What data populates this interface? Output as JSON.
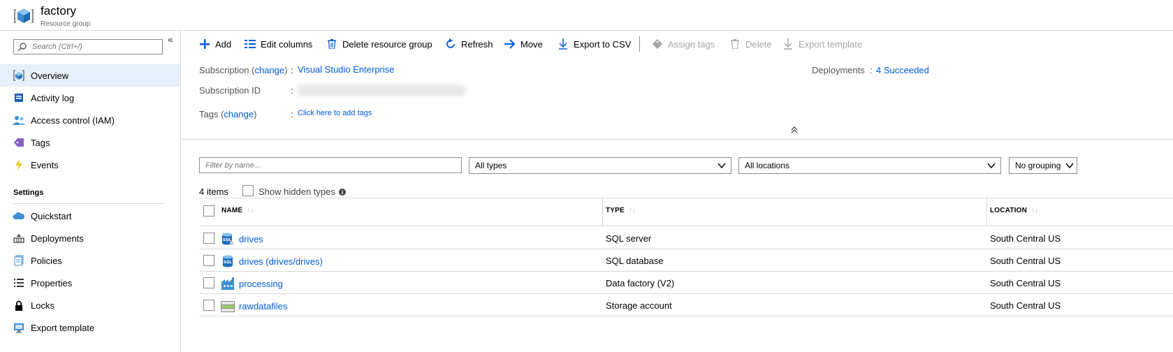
{
  "header": {
    "title": "factory",
    "subtitle": "Resource group",
    "icon": "resource-group-cube-icon"
  },
  "sidebar": {
    "search_placeholder": "Search (Ctrl+/)",
    "collapse_glyph": "«",
    "items": [
      {
        "label": "Overview",
        "icon": "overview-icon"
      },
      {
        "label": "Activity log",
        "icon": "activity-log-icon"
      },
      {
        "label": "Access control (IAM)",
        "icon": "people-icon"
      },
      {
        "label": "Tags",
        "icon": "tag-icon"
      },
      {
        "label": "Events",
        "icon": "lightning-icon"
      }
    ],
    "section": "Settings",
    "settings_items": [
      {
        "label": "Quickstart",
        "icon": "cloud-icon"
      },
      {
        "label": "Deployments",
        "icon": "deployments-icon"
      },
      {
        "label": "Policies",
        "icon": "policies-icon"
      },
      {
        "label": "Properties",
        "icon": "list-icon"
      },
      {
        "label": "Locks",
        "icon": "lock-icon"
      },
      {
        "label": "Export template",
        "icon": "monitor-icon"
      }
    ]
  },
  "toolbar": {
    "add": "Add",
    "edit_columns": "Edit columns",
    "delete_group": "Delete resource group",
    "refresh": "Refresh",
    "move": "Move",
    "export_csv": "Export to CSV",
    "assign_tags": "Assign tags",
    "delete": "Delete",
    "export_template": "Export template"
  },
  "essentials": {
    "subscription_label": "Subscription (",
    "change": "change",
    "subscription_label_end": ")",
    "subscription_value": "Visual Studio Enterprise",
    "subscription_id_label": "Subscription ID",
    "tags_label": "Tags (",
    "tags_link": "Click here to add tags",
    "deployments_label": "Deployments",
    "deployments_value": "4 Succeeded",
    "colon": ":"
  },
  "filters": {
    "name_placeholder": "Filter by name...",
    "types": "All types",
    "locations": "All locations",
    "grouping": "No grouping"
  },
  "list": {
    "count": "4 items",
    "show_hidden": "Show hidden types",
    "columns": [
      "NAME",
      "TYPE",
      "LOCATION"
    ],
    "sort_glyph": "↑↓",
    "rows": [
      {
        "name": "drives",
        "type": "SQL server",
        "location": "South Central US",
        "icon": "sql-server-icon"
      },
      {
        "name": "drives (drives/drives)",
        "type": "SQL database",
        "location": "South Central US",
        "icon": "sql-database-icon"
      },
      {
        "name": "processing",
        "type": "Data factory (V2)",
        "location": "South Central US",
        "icon": "data-factory-icon"
      },
      {
        "name": "rawdatafiles",
        "type": "Storage account",
        "location": "South Central US",
        "icon": "storage-account-icon"
      }
    ]
  },
  "colors": {
    "accent": "#015cda",
    "active_bg": "#e6f0fa"
  }
}
